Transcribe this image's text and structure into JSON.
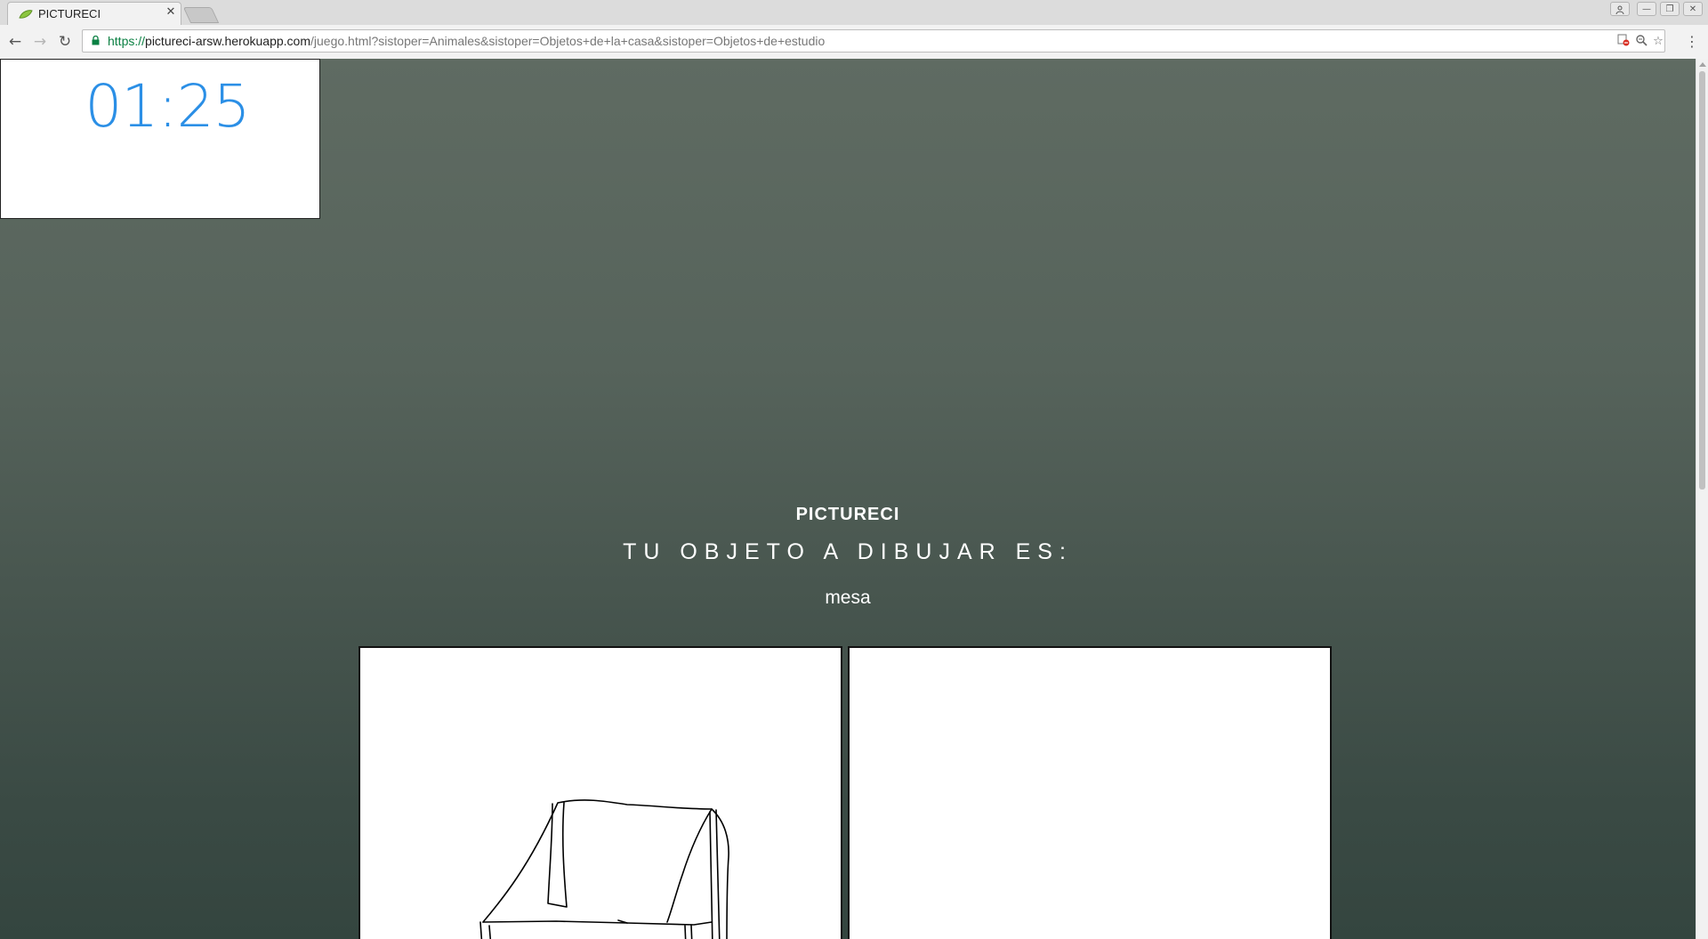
{
  "browser": {
    "tab": {
      "title": "PICTURECI",
      "close_glyph": "✕",
      "favicon": "leaf-favicon-icon"
    },
    "window_controls": {
      "user_glyph": "👤",
      "minimize_glyph": "—",
      "restore_glyph": "❐",
      "close_glyph": "✕"
    },
    "toolbar": {
      "back_glyph": "←",
      "forward_glyph": "→",
      "reload_glyph": "↻",
      "menu_glyph": "⋮"
    },
    "url": {
      "scheme": "https://",
      "host": "pictureci-arsw.herokuapp.com",
      "path": "/juego.html?sistoper=Animales&sistoper=Objetos+de+la+casa&sistoper=Objetos+de+estudio"
    },
    "omnibox_icons": {
      "blocked_glyph": "⛔",
      "zoom_glyph": "🔍",
      "bookmark_glyph": "☆"
    }
  },
  "game": {
    "timer": "01:25",
    "brand": "PICTURECI",
    "instruction": "TU OBJETO A DIBUJAR ES:",
    "word": "mesa"
  },
  "colors": {
    "timer": "#2b8fe6",
    "background_top": "#5f6b62",
    "background_bottom": "#34453f",
    "url_scheme": "#0b8043"
  }
}
